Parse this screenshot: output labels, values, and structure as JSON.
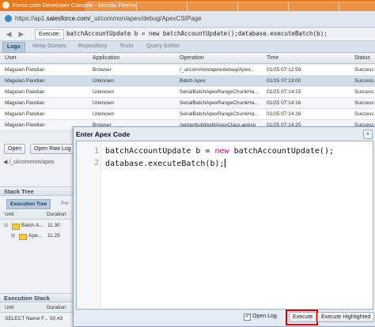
{
  "window": {
    "title": "Force.com Developer Console - Mozilla Firefox"
  },
  "browser": {
    "url_prefix": "https://ap1.",
    "url_domain": "salesforce.com",
    "url_path": "/_ui/common/apex/debug/ApexCSIPage"
  },
  "toolbar": {
    "execute_label": "Execute:",
    "command": "batchAccountUpdate b = new batchAccountUpdate();database.executeBatch(b);"
  },
  "tabs": [
    "Logs",
    "Heap Dumps",
    "Repository",
    "Tests",
    "Query Editor"
  ],
  "logs": {
    "columns": [
      "User",
      "Application",
      "Operation",
      "Time",
      "Status"
    ],
    "rows": [
      {
        "user": "Magulan Pandian",
        "app": "Browser",
        "op": "/_ui/common/apex/debug/Apex...",
        "time": "01/25 07:12:59",
        "status": "Success"
      },
      {
        "user": "Magulan Pandian",
        "app": "Unknown",
        "op": "Batch Apex",
        "time": "01/25 07:13:00",
        "status": "Success"
      },
      {
        "user": "Magulan Pandian",
        "app": "Unknown",
        "op": "SerialBatchApexRangeChunkHa...",
        "time": "01/25 07:14:15",
        "status": "Success"
      },
      {
        "user": "Magulan Pandian",
        "app": "Unknown",
        "op": "SerialBatchApexRangeChunkHa...",
        "time": "01/25 07:14:16",
        "status": "Success"
      },
      {
        "user": "Magulan Pandian",
        "app": "Unknown",
        "op": "SerialBatchApexRangeChunkHa...",
        "time": "01/25 07:14:16",
        "status": "Success"
      },
      {
        "user": "Magulan Pandian",
        "app": "Browser",
        "op": "/setup/build/editApexClass.apexp",
        "time": "01/25 07:14:25",
        "status": "Success"
      }
    ]
  },
  "buttons": {
    "open": "Open",
    "open_raw": "Open Raw Log"
  },
  "left": {
    "file_path": "◀ /_ui/common/apex",
    "stack_tree": "Stack Tree",
    "exec_tree_tab": "Execution Tree",
    "perf_tab": "Per",
    "unit_col": "Unit",
    "duration_col": "Duration",
    "tree": [
      {
        "label": "Batch A...",
        "duration": "11.30"
      },
      {
        "label": "Ape...",
        "duration": "11.25"
      }
    ],
    "exec_stack": "Execution Stack",
    "stack_row": {
      "unit": "SELECT Name F...",
      "duration": "50.43"
    }
  },
  "dialog": {
    "title": "Enter Apex Code",
    "line1": {
      "num": "1",
      "a": "batchAccountUpdate b = ",
      "kw": "new",
      "b": " batchAccountUpdate();"
    },
    "line2": {
      "num": "2",
      "text": "database.executeBatch(b);"
    },
    "open_log": "Open Log",
    "open_log_checked": "✔",
    "execute": "Execute",
    "execute_highlighted": "Execute Highlighted",
    "close": "×"
  }
}
